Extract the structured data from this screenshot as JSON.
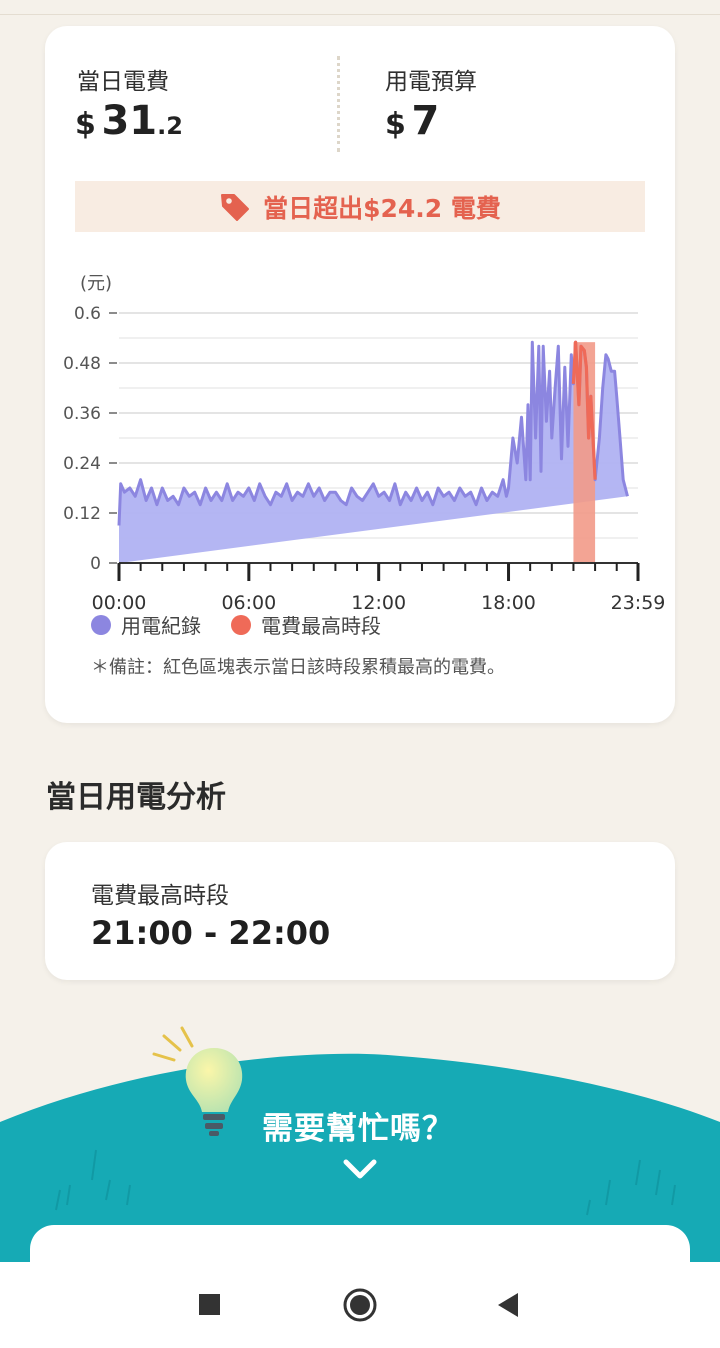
{
  "summary": {
    "daily_cost_label": "當日電費",
    "daily_cost_currency": "$",
    "daily_cost_integer": "31",
    "daily_cost_decimal": ".2",
    "budget_label": "用電預算",
    "budget_currency": "$",
    "budget_value": "7"
  },
  "banner": {
    "text": "當日超出$24.2 電費",
    "icon": "price-tag-icon",
    "color": "#e4624f"
  },
  "chart_data": {
    "type": "area",
    "ylabel": "(元)",
    "ylim": [
      0,
      0.6
    ],
    "yticks": [
      "0",
      "0.12",
      "0.24",
      "0.36",
      "0.48",
      "0.6"
    ],
    "xticks": [
      "00:00",
      "06:00",
      "12:00",
      "18:00",
      "23:59"
    ],
    "xlim_hours": [
      0,
      23.983
    ],
    "highlight_range_hours": [
      21,
      22
    ],
    "series": [
      {
        "name": "用電紀錄",
        "color": "#8c86e0",
        "x_hours": [
          0,
          0.08,
          0.25,
          0.5,
          0.75,
          1,
          1.25,
          1.5,
          1.75,
          2,
          2.25,
          2.5,
          2.75,
          3,
          3.25,
          3.5,
          3.75,
          4,
          4.25,
          4.5,
          4.75,
          5,
          5.25,
          5.5,
          5.75,
          6,
          6.25,
          6.5,
          6.75,
          7,
          7.25,
          7.5,
          7.75,
          8,
          8.25,
          8.5,
          8.75,
          9,
          9.25,
          9.5,
          9.75,
          10,
          10.25,
          10.5,
          10.75,
          11,
          11.25,
          11.5,
          11.75,
          12,
          12.25,
          12.5,
          12.75,
          13,
          13.25,
          13.5,
          13.75,
          14,
          14.25,
          14.5,
          14.75,
          15,
          15.25,
          15.5,
          15.75,
          16,
          16.25,
          16.5,
          16.75,
          17,
          17.25,
          17.5,
          17.75,
          17.9,
          18,
          18.2,
          18.4,
          18.6,
          18.8,
          18.9,
          19,
          19.1,
          19.25,
          19.4,
          19.5,
          19.6,
          19.75,
          19.9,
          20,
          20.15,
          20.3,
          20.45,
          20.6,
          20.75,
          20.9,
          21,
          21.1,
          21.25,
          21.35,
          21.5,
          21.6,
          21.7,
          21.8,
          22,
          22.2,
          22.35,
          22.5,
          22.6,
          22.75,
          22.9,
          23,
          23.15,
          23.3,
          23.5,
          23.7,
          23.983
        ],
        "values": [
          0.09,
          0.19,
          0.17,
          0.18,
          0.16,
          0.2,
          0.15,
          0.18,
          0.14,
          0.18,
          0.15,
          0.16,
          0.14,
          0.18,
          0.16,
          0.17,
          0.14,
          0.18,
          0.15,
          0.17,
          0.15,
          0.19,
          0.15,
          0.17,
          0.16,
          0.18,
          0.15,
          0.19,
          0.16,
          0.14,
          0.17,
          0.16,
          0.19,
          0.15,
          0.17,
          0.16,
          0.19,
          0.16,
          0.18,
          0.15,
          0.17,
          0.17,
          0.15,
          0.14,
          0.18,
          0.16,
          0.15,
          0.17,
          0.19,
          0.16,
          0.17,
          0.15,
          0.19,
          0.14,
          0.17,
          0.15,
          0.18,
          0.15,
          0.17,
          0.14,
          0.18,
          0.16,
          0.17,
          0.15,
          0.18,
          0.16,
          0.17,
          0.14,
          0.18,
          0.15,
          0.17,
          0.16,
          0.2,
          0.16,
          0.18,
          0.3,
          0.24,
          0.35,
          0.2,
          0.38,
          0.2,
          0.53,
          0.3,
          0.52,
          0.22,
          0.52,
          0.34,
          0.46,
          0.3,
          0.42,
          0.52,
          0.25,
          0.47,
          0.28,
          0.5,
          0.43,
          0.53,
          0.38,
          0.52,
          0.51,
          0.47,
          0.3,
          0.4,
          0.2,
          0.3,
          0.42,
          0.5,
          0.49,
          0.46,
          0.46,
          0.4,
          0.3,
          0.2,
          0.16
        ]
      },
      {
        "name": "電費最高時段",
        "color": "#ef6a58"
      }
    ]
  },
  "legend": {
    "usage_label": "用電紀錄",
    "usage_color": "#8c86e0",
    "peak_label": "電費最高時段",
    "peak_color": "#ef6a58"
  },
  "note": "＊備註：紅色區塊表示當日該時段累積最高的電費。",
  "analysis": {
    "title": "當日用電分析",
    "peak_label": "電費最高時段",
    "peak_value": "21:00 - 22:00"
  },
  "help": {
    "text": "需要幫忙嗎？",
    "teal_color": "#16aab5",
    "icon": "lightbulb-icon",
    "expand_icon": "chevron-down-icon"
  },
  "navbar": {
    "recents_icon": "square-icon",
    "home_icon": "circle-home-icon",
    "back_icon": "triangle-back-icon"
  }
}
